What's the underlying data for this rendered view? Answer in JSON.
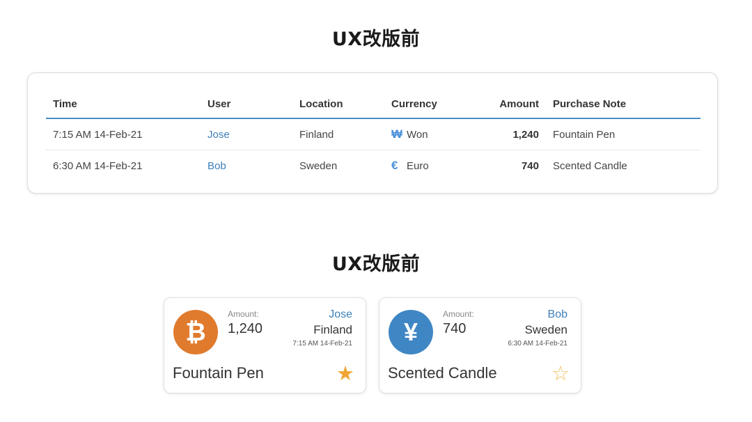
{
  "sections": [
    {
      "title": "UX改版前"
    },
    {
      "title": "UX改版前"
    }
  ],
  "table": {
    "columns": [
      "Time",
      "User",
      "Location",
      "Currency",
      "Amount",
      "Purchase Note"
    ],
    "rows": [
      {
        "time": "7:15 AM 14-Feb-21",
        "user": "Jose",
        "location": "Finland",
        "currency_icon": "₩",
        "currency_icon_name": "won-icon",
        "currency": "Won",
        "amount": "1,240",
        "note": "Fountain Pen"
      },
      {
        "time": "6:30 AM 14-Feb-21",
        "user": "Bob",
        "location": "Sweden",
        "currency_icon": "€",
        "currency_icon_name": "euro-icon",
        "currency": "Euro",
        "amount": "740",
        "note": "Scented Candle"
      }
    ]
  },
  "cards": [
    {
      "coin_glyph": "₿",
      "coin_icon_name": "bitcoin-icon",
      "coin_color": "#e07b2e",
      "amount_label": "Amount:",
      "amount": "1,240",
      "user": "Jose",
      "location": "Finland",
      "time": "7:15 AM 14-Feb-21",
      "note": "Fountain Pen",
      "starred": true,
      "star_glyph": "★"
    },
    {
      "coin_glyph": "¥",
      "coin_icon_name": "yen-icon",
      "coin_color": "#3f86c4",
      "amount_label": "Amount:",
      "amount": "740",
      "user": "Bob",
      "location": "Sweden",
      "time": "6:30 AM 14-Feb-21",
      "note": "Scented Candle",
      "starred": false,
      "star_glyph": "☆"
    }
  ],
  "colors": {
    "accent": "#4a8cc4",
    "link": "#3d7fb8",
    "star": "#f0a534"
  }
}
